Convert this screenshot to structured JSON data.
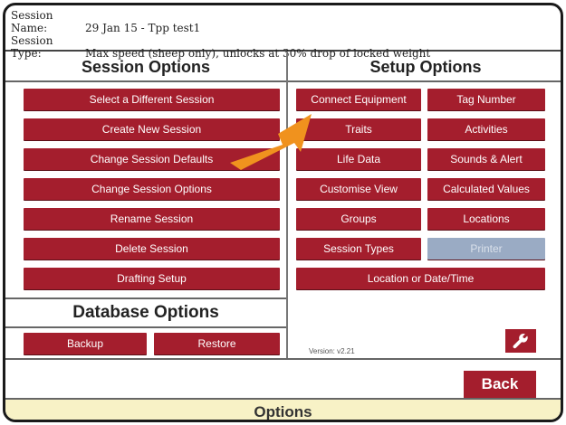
{
  "header": {
    "session_name_label": "Session Name:",
    "session_name_value": "29 Jan 15 - Tpp test1",
    "session_type_label": "Session Type:",
    "session_type_value": "Max speed (sheep only), unlocks at 30% drop of locked weight"
  },
  "session_options": {
    "title": "Session Options",
    "buttons": [
      "Select a Different Session",
      "Create New Session",
      "Change Session Defaults",
      "Change Session Options",
      "Rename Session",
      "Delete Session",
      "Drafting Setup"
    ]
  },
  "database_options": {
    "title": "Database Options",
    "backup_label": "Backup",
    "restore_label": "Restore"
  },
  "setup_options": {
    "title": "Setup Options",
    "left_buttons": [
      "Connect Equipment",
      "Traits",
      "Life Data",
      "Customise View",
      "Groups",
      "Session Types"
    ],
    "right_buttons": [
      "Tag Number",
      "Activities",
      "Sounds & Alert",
      "Calculated Values",
      "Locations",
      "Printer"
    ],
    "wide_button": "Location or Date/Time",
    "printer_state": "disabled"
  },
  "version": "Version: v2.21",
  "wrench_icon": "wrench-icon",
  "back_label": "Back",
  "footer_title": "Options",
  "colors": {
    "button_red": "#a41e2d",
    "disabled_button": "#9aabc4",
    "footer_bg": "#f8f2c6",
    "arrow_orange": "#f0921e"
  }
}
